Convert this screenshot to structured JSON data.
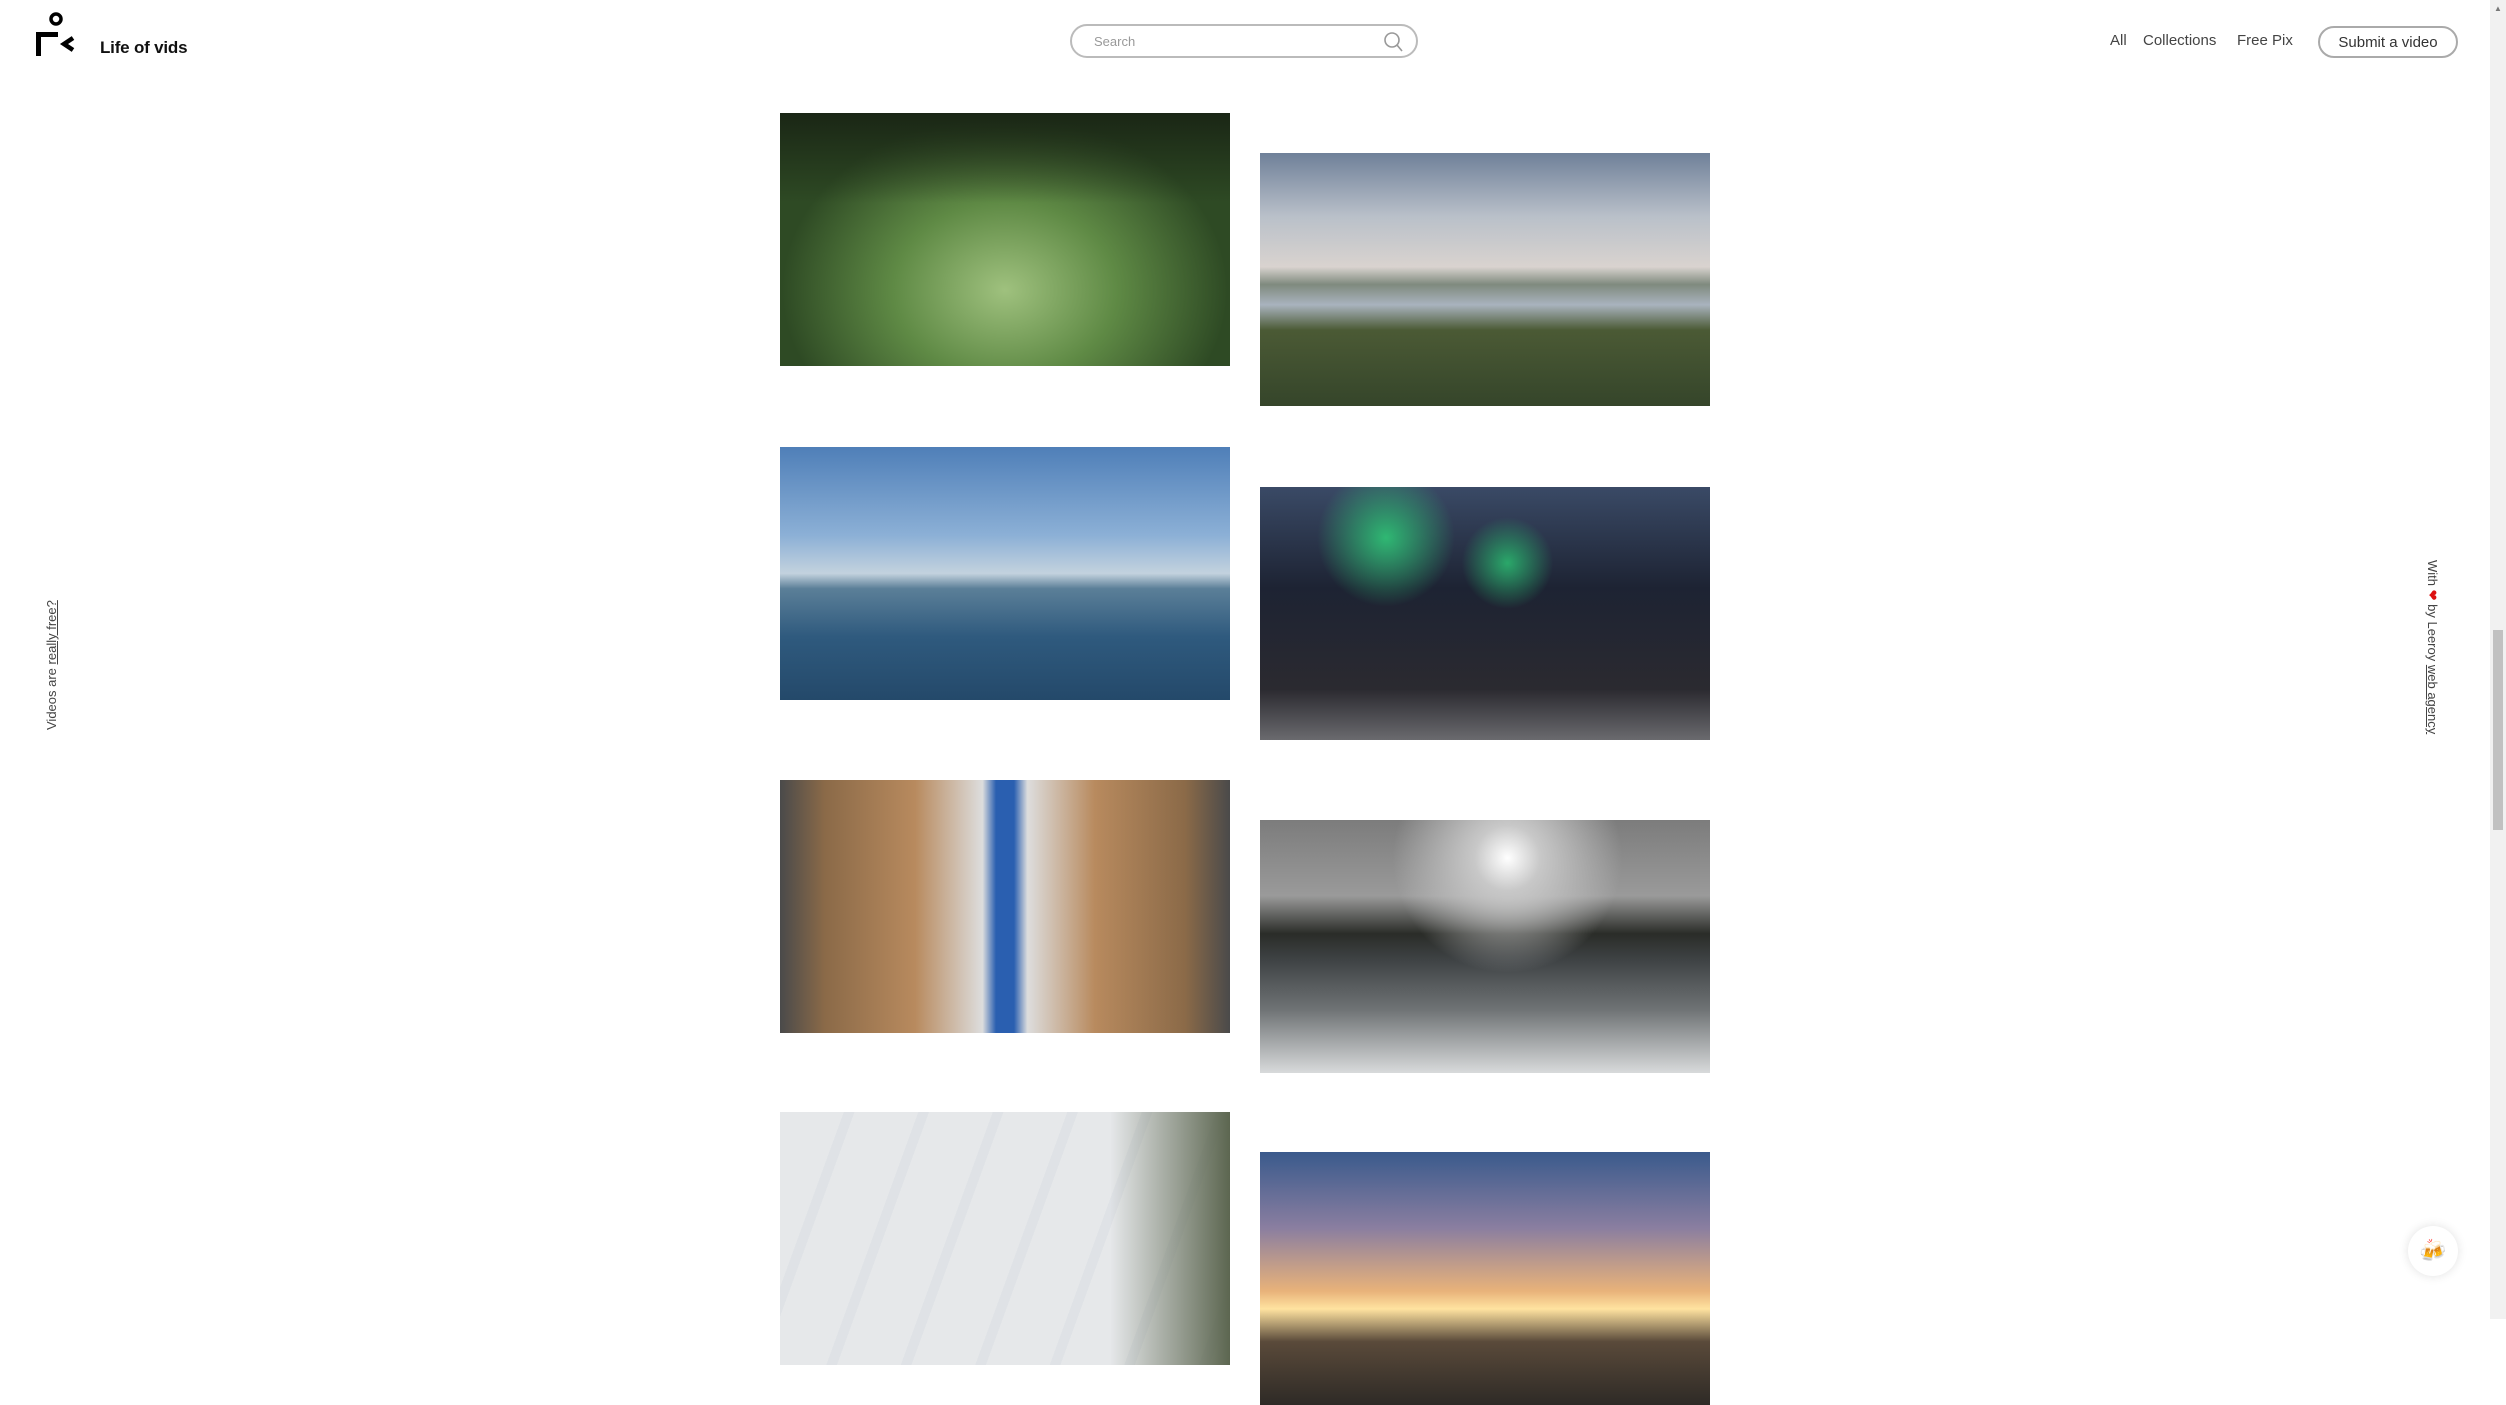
{
  "header": {
    "brand": "Life of vids",
    "search": {
      "placeholder": "Search",
      "value": ""
    },
    "nav": [
      {
        "label": "All"
      },
      {
        "label": "Collections"
      },
      {
        "label": "Free Pix"
      }
    ],
    "submit_label": "Submit a video"
  },
  "side_left": {
    "prefix": "Videos are ",
    "link": "really free?"
  },
  "side_right": {
    "prefix": "With ",
    "heart": "❤",
    "middle": " by Leeroy ",
    "link": "web agency"
  },
  "chat_widget": {
    "icon": "beer-mugs-icon",
    "glyph": "🍻"
  },
  "videos": [
    {
      "icon": "video-thumbnail"
    },
    {
      "icon": "video-thumbnail"
    },
    {
      "icon": "video-thumbnail"
    },
    {
      "icon": "video-thumbnail"
    },
    {
      "icon": "video-thumbnail"
    },
    {
      "icon": "video-thumbnail"
    },
    {
      "icon": "video-thumbnail"
    },
    {
      "icon": "video-thumbnail"
    }
  ]
}
